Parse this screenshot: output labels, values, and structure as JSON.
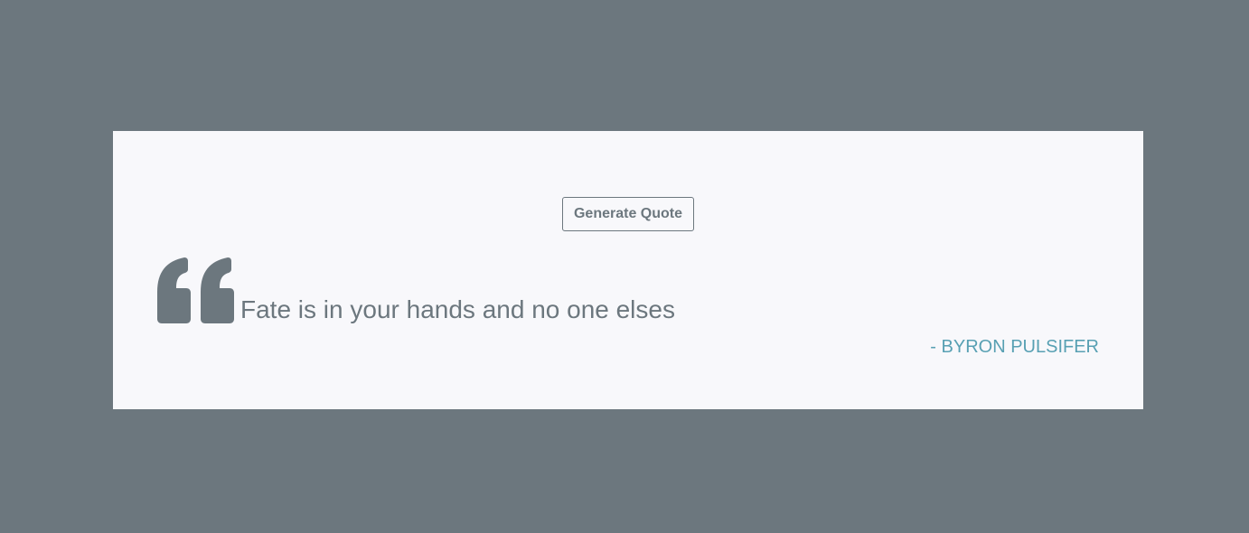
{
  "page": {
    "background_color": "#6c777e"
  },
  "card": {
    "background_color": "#f8f8fb",
    "generate_button_label": "Generate Quote",
    "quote_icon": "quote-left-icon",
    "quote_text": "Fate is in your hands and no one elses",
    "author": "- BYRON PULSIFER",
    "text_color": "#6c777e",
    "author_color": "#58a0b3"
  }
}
